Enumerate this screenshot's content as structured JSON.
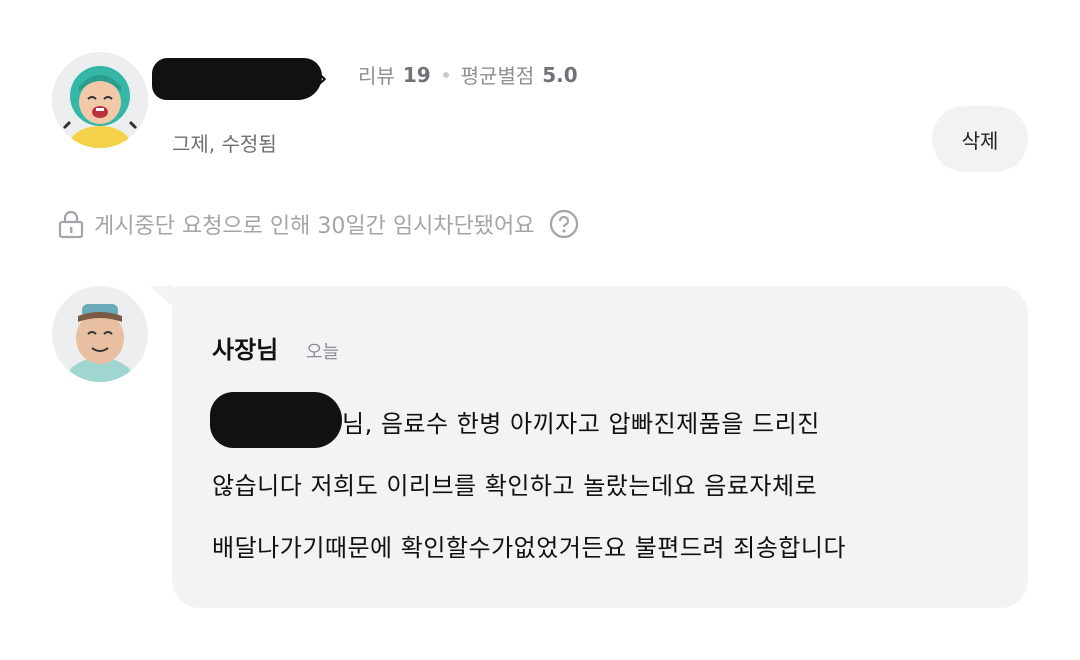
{
  "review": {
    "meta_review_label": "리뷰",
    "meta_review_count": "19",
    "meta_rating_label": "평균별점",
    "meta_rating_value": "5.0",
    "edited_text": "그제, 수정됨",
    "delete_label": "삭제",
    "notice_text": "게시중단 요청으로 인해 30일간 임시차단됐어요"
  },
  "reply": {
    "owner_name": "사장님",
    "time": "오늘",
    "lines": [
      "님, 음료수 한병 아끼자고 압빠진제품을 드리진",
      "않습니다 저희도 이리브를 확인하고 놀랐는데요 음료자체로",
      "배달나가기때문에 확인할수가없었거든요 불편드려 죄송합니다"
    ]
  },
  "icons": {
    "user_avatar": "avatar-girl-helmet-icon",
    "owner_avatar": "avatar-chef-icon",
    "chevron": "chevron-right-icon",
    "lock": "lock-icon",
    "help": "question-circle-icon"
  },
  "colors": {
    "bubble_bg": "#f2f3f5",
    "muted_text": "#a2a5a9",
    "button_bg": "#f1f2f4"
  }
}
